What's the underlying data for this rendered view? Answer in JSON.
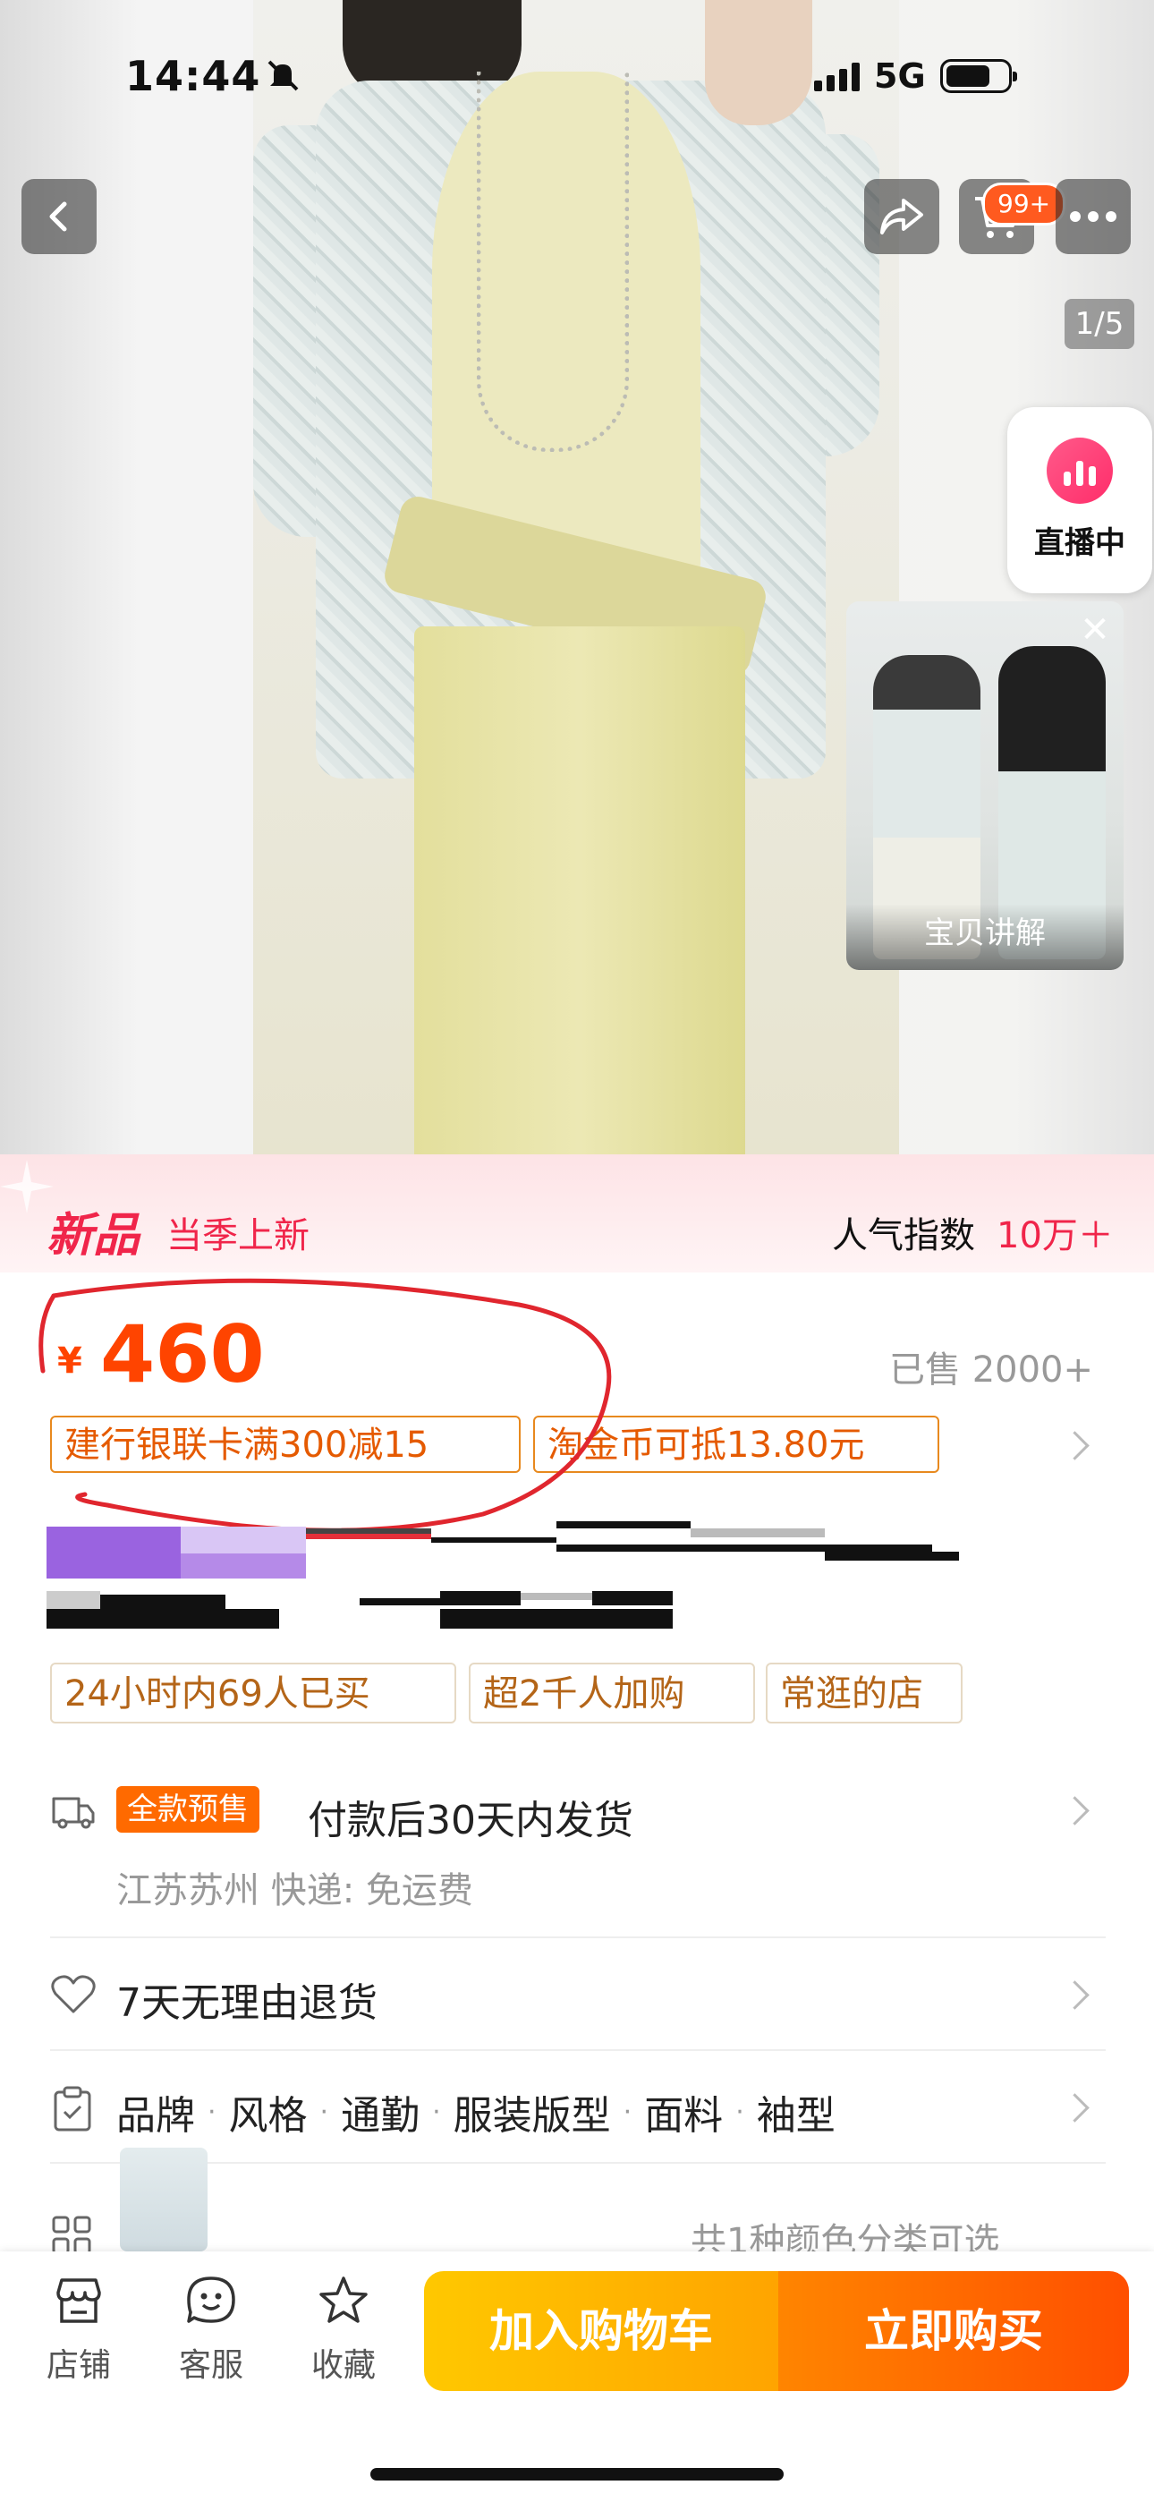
{
  "status_bar": {
    "time": "14:44",
    "network": "5G"
  },
  "gallery": {
    "page_indicator": "1/5",
    "cart_badge": "99+"
  },
  "live": {
    "label": "直播中",
    "video_label": "宝贝讲解"
  },
  "banner": {
    "logo": "新品",
    "subtitle": "当季上新",
    "popularity_label": "人气指数",
    "popularity_value": "10万＋"
  },
  "price": {
    "currency": "¥",
    "amount": "460",
    "sold": "已售 2000+"
  },
  "coupons": [
    "建行银联卡满300减15",
    "淘金币可抵13.80元"
  ],
  "tags": [
    "24小时内69人已买",
    "超2千人加购",
    "常逛的店"
  ],
  "shipping": {
    "badge": "全款预售",
    "text": "付款后30天内发货",
    "sub": "江苏苏州  快递: 免运费"
  },
  "returns": {
    "text": "7天无理由退货"
  },
  "attributes": [
    "品牌",
    "风格",
    "通勤",
    "服装版型",
    "面料",
    "袖型"
  ],
  "sku": {
    "text": "共1种颜色分类可选"
  },
  "bottom_nav": {
    "store": "店铺",
    "service": "客服",
    "favorite": "收藏"
  },
  "actions": {
    "add_to_cart": "加入购物车",
    "buy_now": "立即购买"
  },
  "colors": {
    "accent": "#ff4400",
    "new_red": "#f0254a",
    "cart_yellow": "#ffb400",
    "buy_orange": "#ff5a00"
  }
}
